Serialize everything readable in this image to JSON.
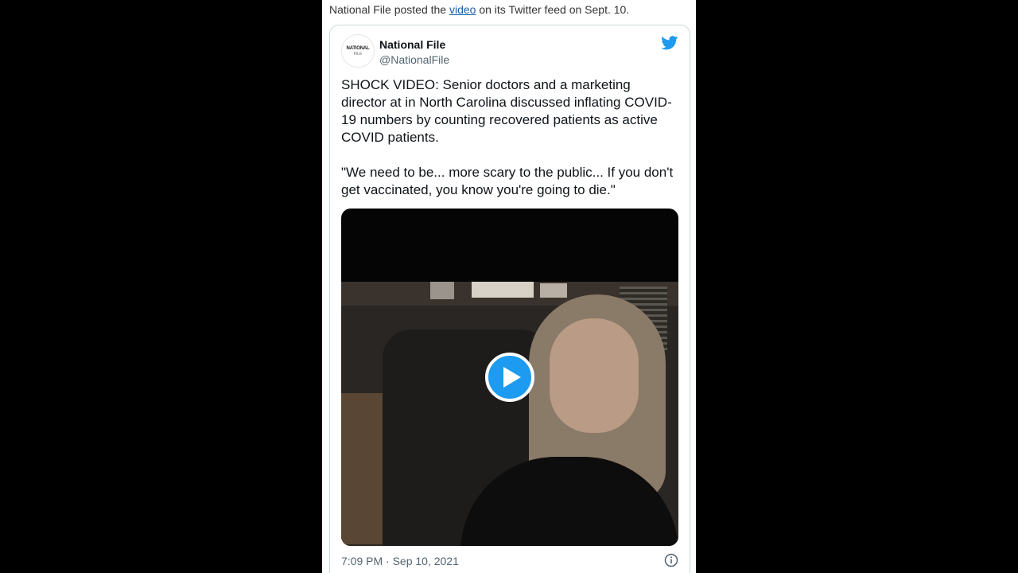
{
  "caption": {
    "prefix": "National File posted the ",
    "link": "video",
    "suffix": " on its Twitter feed on Sept. 10."
  },
  "tweet": {
    "avatar_line1": "NATIONAL",
    "avatar_line2": "FILE",
    "name": "National File",
    "handle": "@NationalFile",
    "text": "SHOCK VIDEO: Senior doctors and a marketing director at in North Carolina discussed inflating COVID-19 numbers by counting recovered patients as active COVID patients.\n\n\"We need to be... more scary to the public... If you don't get vaccinated, you know you're going to die.\"",
    "timestamp": "7:09 PM · Sep 10, 2021"
  },
  "icons": {
    "brand": "twitter-bird-icon",
    "play": "play-icon",
    "info": "info-icon"
  },
  "colors": {
    "twitter_blue": "#1d9bf0",
    "link": "#1a5fa8",
    "muted": "#536471"
  }
}
